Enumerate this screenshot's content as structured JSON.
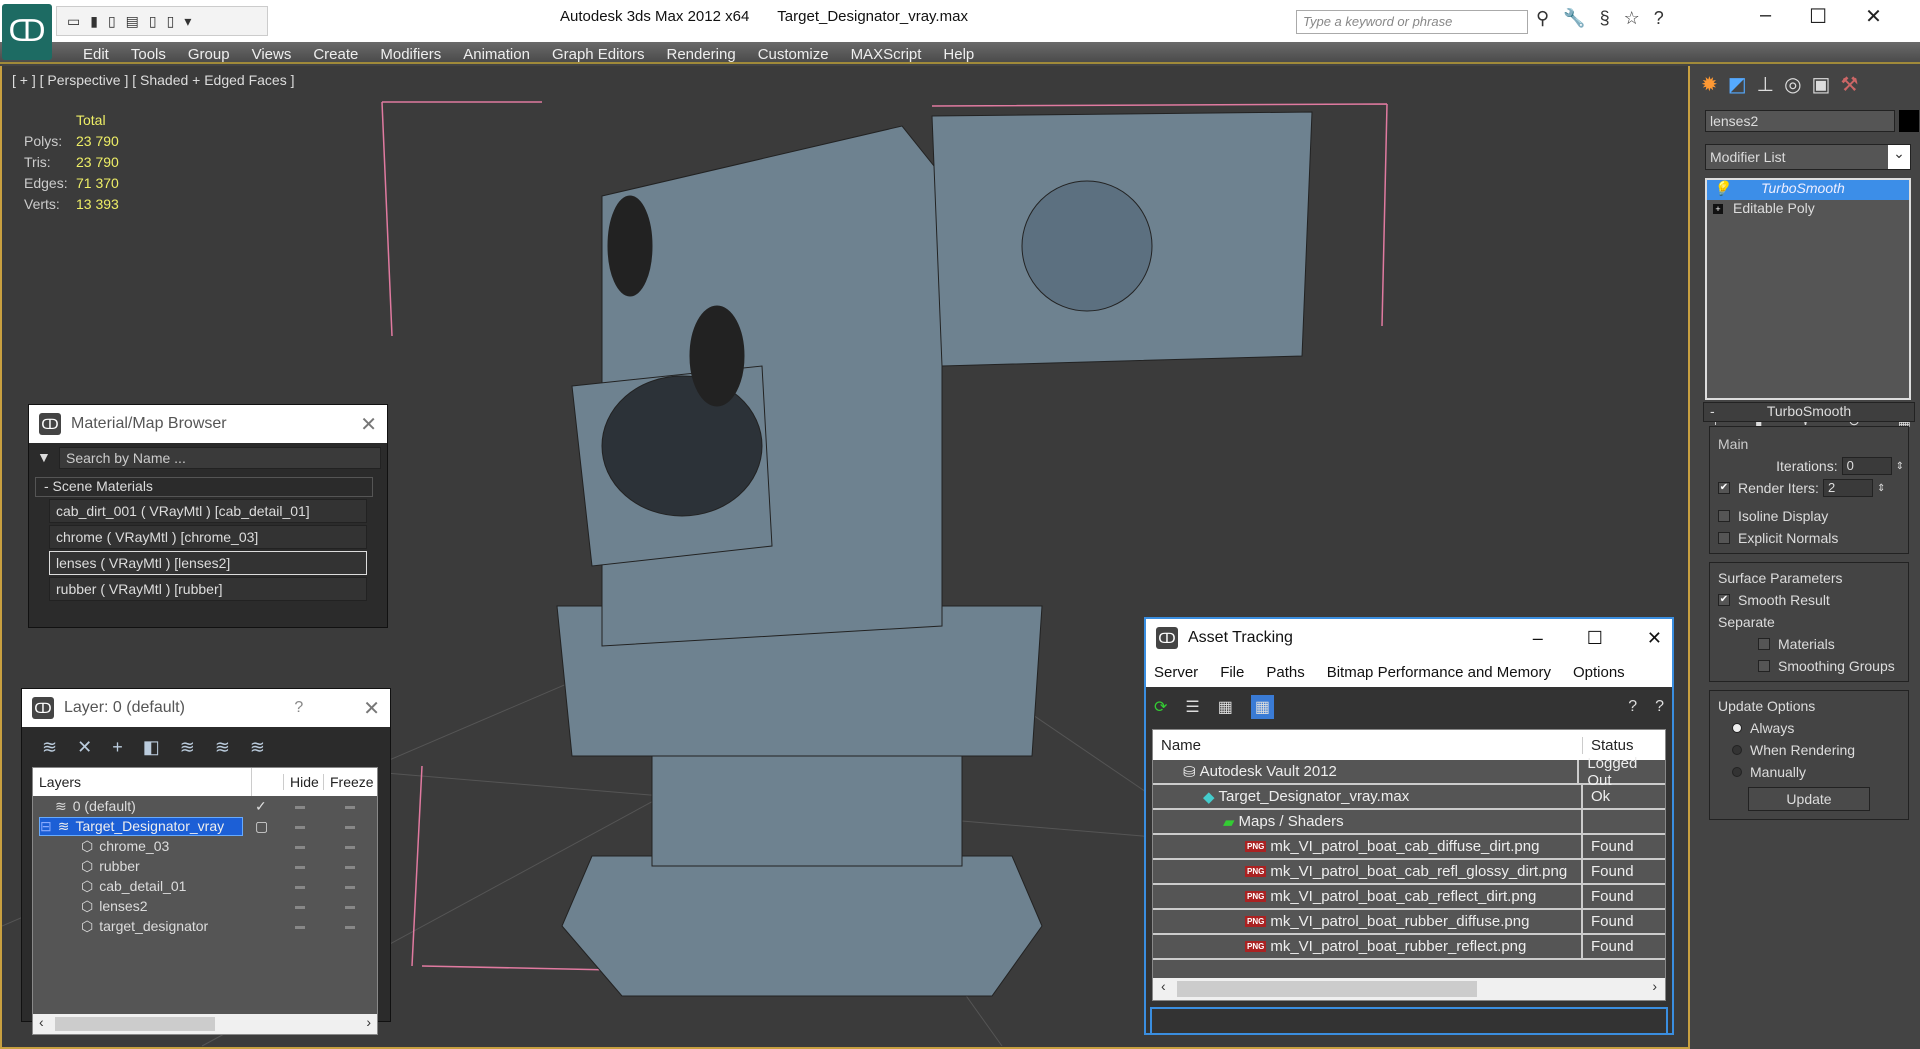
{
  "titlebar": {
    "app": "Autodesk 3ds Max  2012 x64",
    "file": "Target_Designator_vray.max",
    "search_placeholder": "Type a keyword or phrase"
  },
  "menu": [
    "Edit",
    "Tools",
    "Group",
    "Views",
    "Create",
    "Modifiers",
    "Animation",
    "Graph Editors",
    "Rendering",
    "Customize",
    "MAXScript",
    "Help"
  ],
  "viewport": {
    "label": "[ + ] [ Perspective ] [ Shaded + Edged Faces ]",
    "stats": {
      "header": "Total",
      "rows": [
        {
          "k": "Polys:",
          "v": "23 790"
        },
        {
          "k": "Tris:",
          "v": "23 790"
        },
        {
          "k": "Edges:",
          "v": "71 370"
        },
        {
          "k": "Verts:",
          "v": "13 393"
        }
      ]
    }
  },
  "material_browser": {
    "title": "Material/Map Browser",
    "search_placeholder": "Search by Name ...",
    "group": "- Scene Materials",
    "items": [
      "cab_dirt_001  ( VRayMtl ) [cab_detail_01]",
      "chrome  ( VRayMtl ) [chrome_03]",
      "lenses  ( VRayMtl ) [lenses2]",
      "rubber  ( VRayMtl ) [rubber]"
    ],
    "selected": 2
  },
  "layers": {
    "title": "Layer: 0 (default)",
    "help": "?",
    "cols": [
      "Layers",
      "Hide",
      "Freeze"
    ],
    "rows": [
      "0 (default)",
      "Target_Designator_vray",
      "chrome_03",
      "rubber",
      "cab_detail_01",
      "lenses2",
      "target_designator"
    ]
  },
  "asset": {
    "title": "Asset Tracking",
    "menu": [
      "Server",
      "File",
      "Paths",
      "Bitmap Performance and Memory",
      "Options"
    ],
    "cols": [
      "Name",
      "Status"
    ],
    "rows": [
      {
        "name": "Autodesk Vault 2012",
        "status": "Logged Out"
      },
      {
        "name": "Target_Designator_vray.max",
        "status": "Ok"
      },
      {
        "name": "Maps / Shaders",
        "status": ""
      },
      {
        "name": "mk_VI_patrol_boat_cab_diffuse_dirt.png",
        "status": "Found"
      },
      {
        "name": "mk_VI_patrol_boat_cab_refl_glossy_dirt.png",
        "status": "Found"
      },
      {
        "name": "mk_VI_patrol_boat_cab_reflect_dirt.png",
        "status": "Found"
      },
      {
        "name": "mk_VI_patrol_boat_rubber_diffuse.png",
        "status": "Found"
      },
      {
        "name": "mk_VI_patrol_boat_rubber_reflect.png",
        "status": "Found"
      }
    ]
  },
  "command": {
    "object_name": "lenses2",
    "modifier_list": "Modifier List",
    "stack": [
      "TurboSmooth",
      "Editable Poly"
    ],
    "rollout": "TurboSmooth",
    "main": "Main",
    "iterations_label": "Iterations:",
    "iterations": "0",
    "render_iters_label": "Render Iters:",
    "render_iters": "2",
    "isoline": "Isoline Display",
    "explicit": "Explicit Normals",
    "surface": "Surface Parameters",
    "smooth_result": "Smooth Result",
    "separate": "Separate",
    "materials": "Materials",
    "smoothing_groups": "Smoothing Groups",
    "update_options": "Update Options",
    "always": "Always",
    "when_rendering": "When Rendering",
    "manually": "Manually",
    "update": "Update"
  }
}
